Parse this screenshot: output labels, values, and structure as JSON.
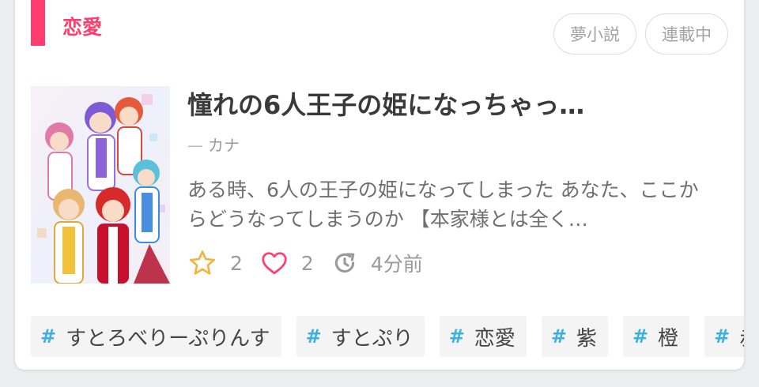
{
  "card": {
    "genre": "恋愛",
    "pills": [
      "夢小説",
      "連載中"
    ],
    "title": "憧れの6人王子の姫になっちゃっ…",
    "author_dash": "—",
    "author": "カナ",
    "synopsis": "ある時、6人の王子の姫になってしまった あなた、ここからどうなってしまうのか 【本家様とは全く…",
    "stats": {
      "stars": "2",
      "likes": "2",
      "updated": "4分前"
    },
    "tag_hash": "#",
    "tags": [
      "すとろべりーぷりんす",
      "すとぷり",
      "恋愛",
      "紫",
      "橙",
      "赤"
    ]
  },
  "colors": {
    "accent": "#ff3d6e",
    "star": "#f5b342",
    "heart": "#ff3d6e",
    "hash": "#3ab0e6"
  },
  "icons": {
    "star": "star-icon",
    "heart": "heart-icon",
    "updated": "history-icon"
  }
}
